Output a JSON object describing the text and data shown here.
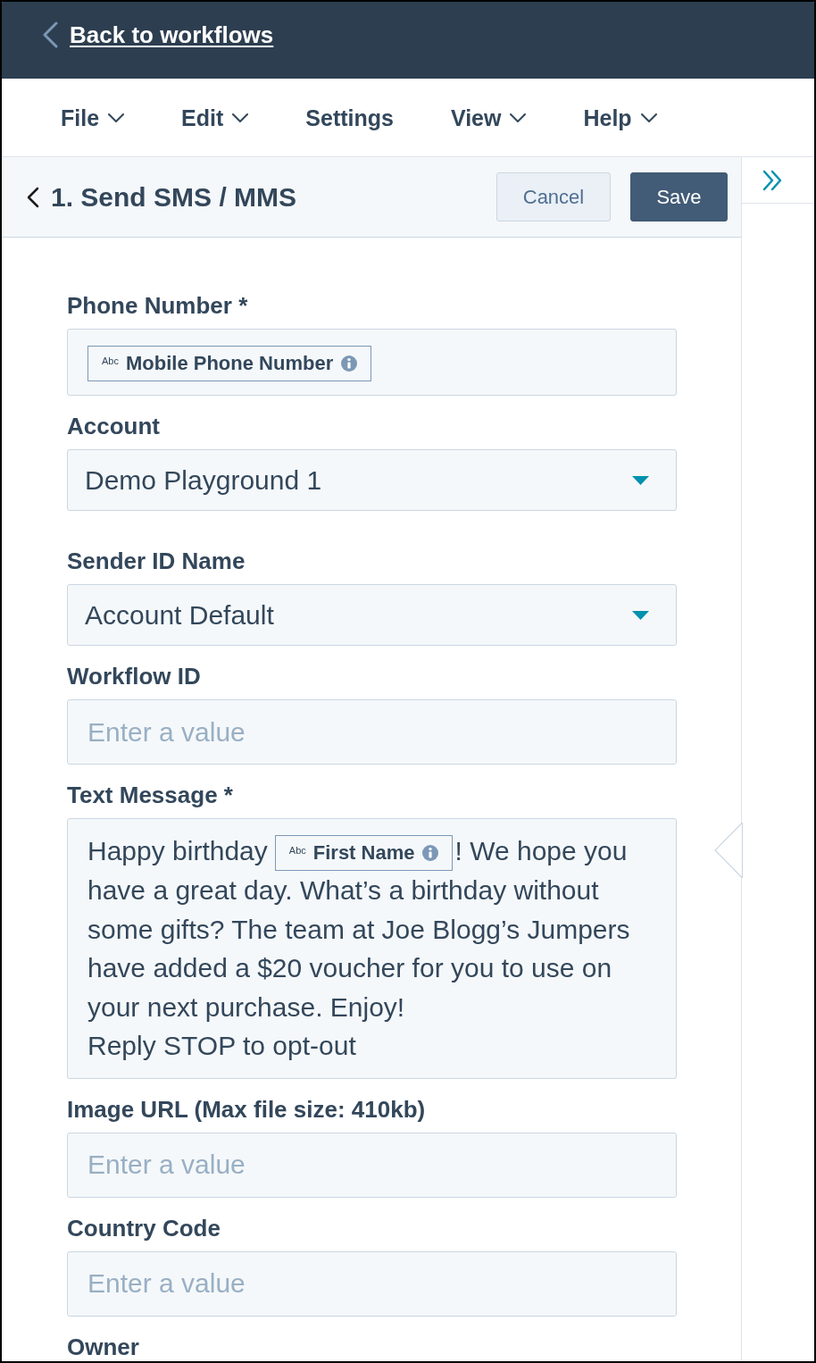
{
  "header": {
    "back_link": "Back to workflows"
  },
  "menu": [
    {
      "label": "File",
      "dropdown": true
    },
    {
      "label": "Edit",
      "dropdown": true
    },
    {
      "label": "Settings",
      "dropdown": false
    },
    {
      "label": "View",
      "dropdown": true
    },
    {
      "label": "Help",
      "dropdown": true
    }
  ],
  "panel": {
    "title": "1. Send SMS / MMS",
    "buttons": [
      {
        "label": "Cancel",
        "kind": "secondary"
      },
      {
        "label": "Save",
        "kind": "primary"
      }
    ]
  },
  "fields": [
    {
      "kind": "token",
      "label": "Phone Number *",
      "token": {
        "badge": "Abc",
        "label": "Mobile Phone Number"
      }
    },
    {
      "kind": "select",
      "label": "Account",
      "value": "Demo Playground 1"
    },
    {
      "kind": "select",
      "label": "Sender ID Name",
      "value": "Account Default"
    },
    {
      "kind": "text",
      "label": "Workflow ID",
      "placeholder": "Enter a value"
    },
    {
      "kind": "message",
      "label": "Text Message *",
      "paragraphs": [
        [
          {
            "kind": "text",
            "text": "Happy birthday"
          },
          {
            "kind": "token",
            "badge": "Abc",
            "label": "First Name"
          },
          {
            "kind": "text",
            "text": "! We hope you have a great day. What’s a birthday without some gifts? The team at Joe Blogg’s Jumpers have added a $20 voucher for you to use on your next purchase. Enjoy!"
          }
        ],
        [
          {
            "kind": "text",
            "text": "Reply STOP to opt-out"
          }
        ]
      ]
    },
    {
      "kind": "text",
      "label": "Image URL (Max file size: 410kb)",
      "placeholder": "Enter a value"
    },
    {
      "kind": "text",
      "label": "Country Code",
      "placeholder": "Enter a value"
    },
    {
      "kind": "clipped",
      "label": "Owner"
    }
  ]
}
